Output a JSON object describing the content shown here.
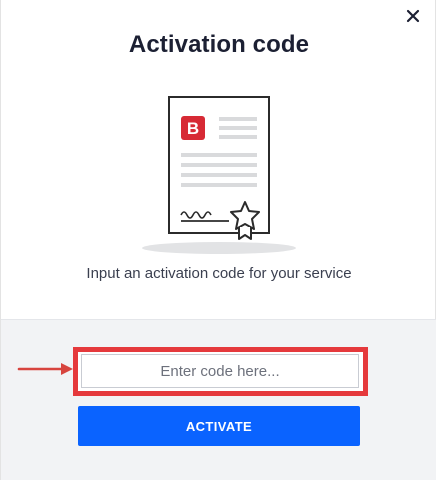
{
  "dialog": {
    "title": "Activation code",
    "close_icon": "close-icon",
    "subtitle": "Input an activation code for your service"
  },
  "illustration": {
    "icon": "certificate-icon",
    "badge_letter": "B",
    "colors": {
      "badge": "#d72a35",
      "outline": "#2b2b2b",
      "lines": "#d9dadc"
    }
  },
  "form": {
    "code_placeholder": "Enter code here...",
    "code_value": "",
    "activate_label": "ACTIVATE"
  },
  "annotations": {
    "arrow_icon": "red-arrow-icon",
    "highlight_color": "#e5393c"
  },
  "colors": {
    "accent": "#0a63ff",
    "title_text": "#1c2033",
    "panel_bg": "#f2f3f5"
  }
}
